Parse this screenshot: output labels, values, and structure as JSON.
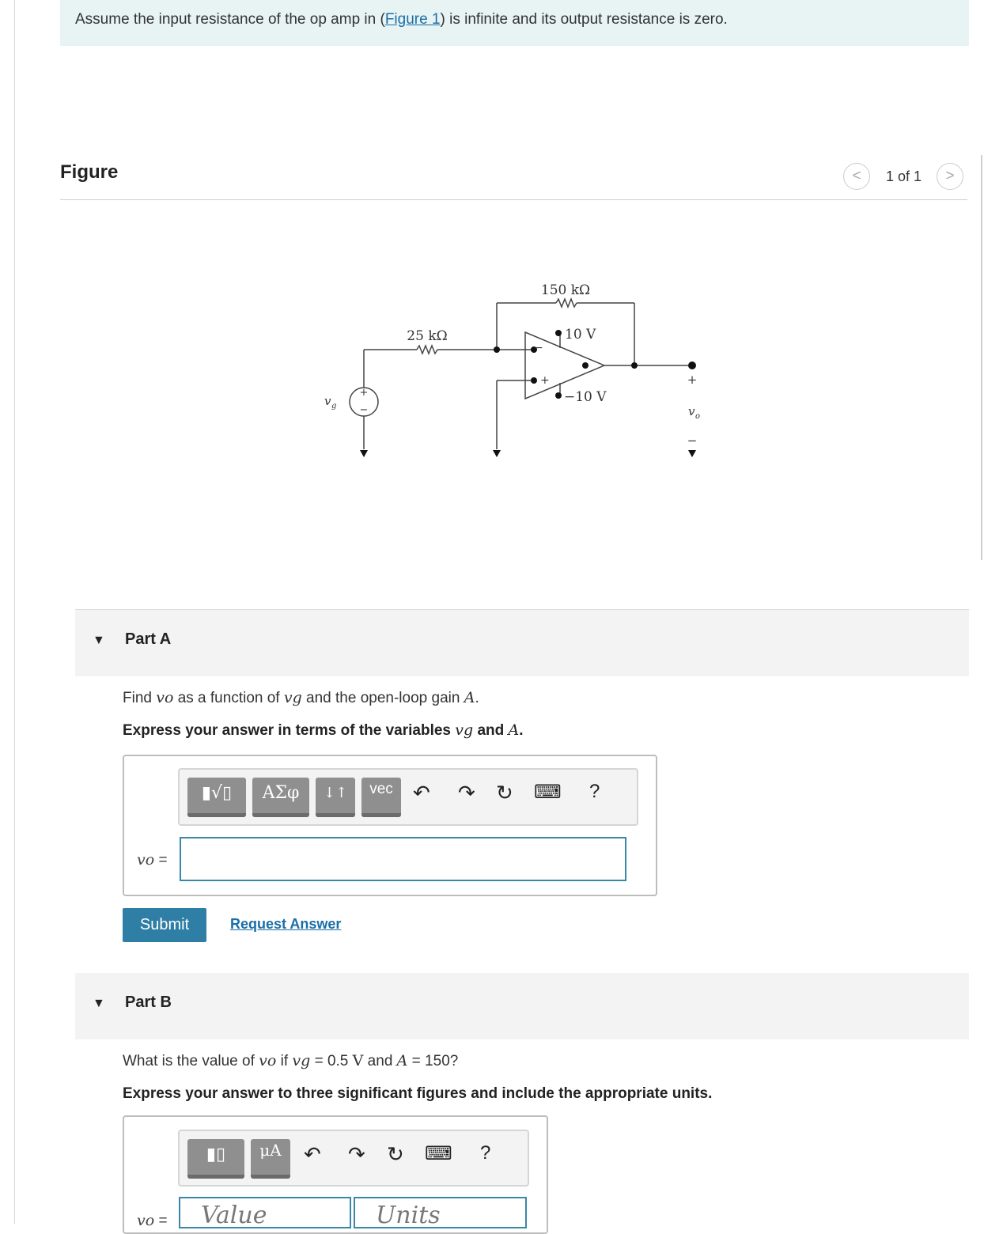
{
  "intro": {
    "before": "Assume the input resistance of the op amp in (",
    "link": "Figure 1",
    "after": ") is infinite and its output resistance is zero."
  },
  "figure": {
    "title": "Figure",
    "pager": "1 of 1",
    "prev_icon": "chevron-left-icon",
    "next_icon": "chevron-right-icon"
  },
  "circuit": {
    "r1": "25 kΩ",
    "r2": "150 kΩ",
    "vpos": "10 V",
    "vneg": "−10 V",
    "vg": "v",
    "vg_sub": "g",
    "vo": "v",
    "vo_sub": "o",
    "plus": "+",
    "minus": "−"
  },
  "partA": {
    "label": "Part A",
    "q_find": "Find ",
    "q_vo": "vo",
    "q_mid": " as a function of ",
    "q_vg": "vg",
    "q_end": " and the open-loop gain ",
    "q_A": "A",
    "q_dot": ".",
    "instr": "Express your answer in terms of the variables ",
    "instr_vg": "vg",
    "instr_and": " and ",
    "instr_A": "A",
    "instr_dot": ".",
    "eq_var": "vo",
    "eq_sign": " =",
    "toolbar": {
      "templates": "▮√▯",
      "greek": "ΑΣφ",
      "arrows": "↓↑",
      "vec": "vec"
    },
    "submit": "Submit",
    "request": "Request Answer"
  },
  "partB": {
    "label": "Part B",
    "q_a": "What is the value of ",
    "q_vo": "vo",
    "q_b": " if ",
    "q_vg": "vg",
    "q_c": " = 0.5 ",
    "q_V": "V",
    "q_d": " and ",
    "q_A": "A",
    "q_e": " = 150?",
    "instr": "Express your answer to three significant figures and include the appropriate units.",
    "toolbar": {
      "templates": "▮▯",
      "units": "μA"
    },
    "eq_var": "vo",
    "eq_sign": " =",
    "value_placeholder": "Value",
    "units_placeholder": "Units"
  }
}
